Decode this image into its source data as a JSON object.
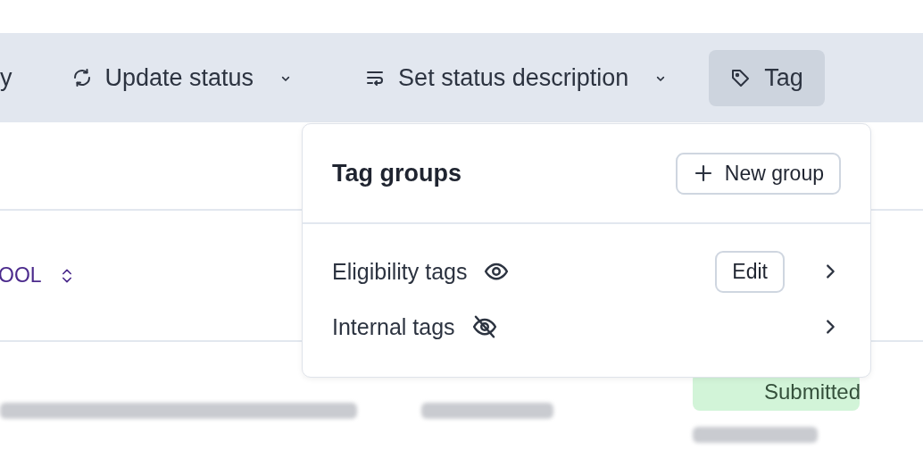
{
  "toolbar": {
    "items": [
      {
        "kind": "text",
        "label": "y"
      },
      {
        "kind": "dropdown",
        "label": "Update status"
      },
      {
        "kind": "dropdown",
        "label": "Set status description"
      },
      {
        "kind": "button",
        "label": "Tag",
        "selected": true
      }
    ]
  },
  "table": {
    "header": {
      "label": "OOL"
    },
    "rows": [
      {
        "status": "Submitted"
      }
    ]
  },
  "tag_menu": {
    "title": "Tag groups",
    "new_button": "New group",
    "groups": [
      {
        "name": "Eligibility tags",
        "visible": true,
        "edit": "Edit"
      },
      {
        "name": "Internal tags",
        "visible": false
      }
    ]
  }
}
